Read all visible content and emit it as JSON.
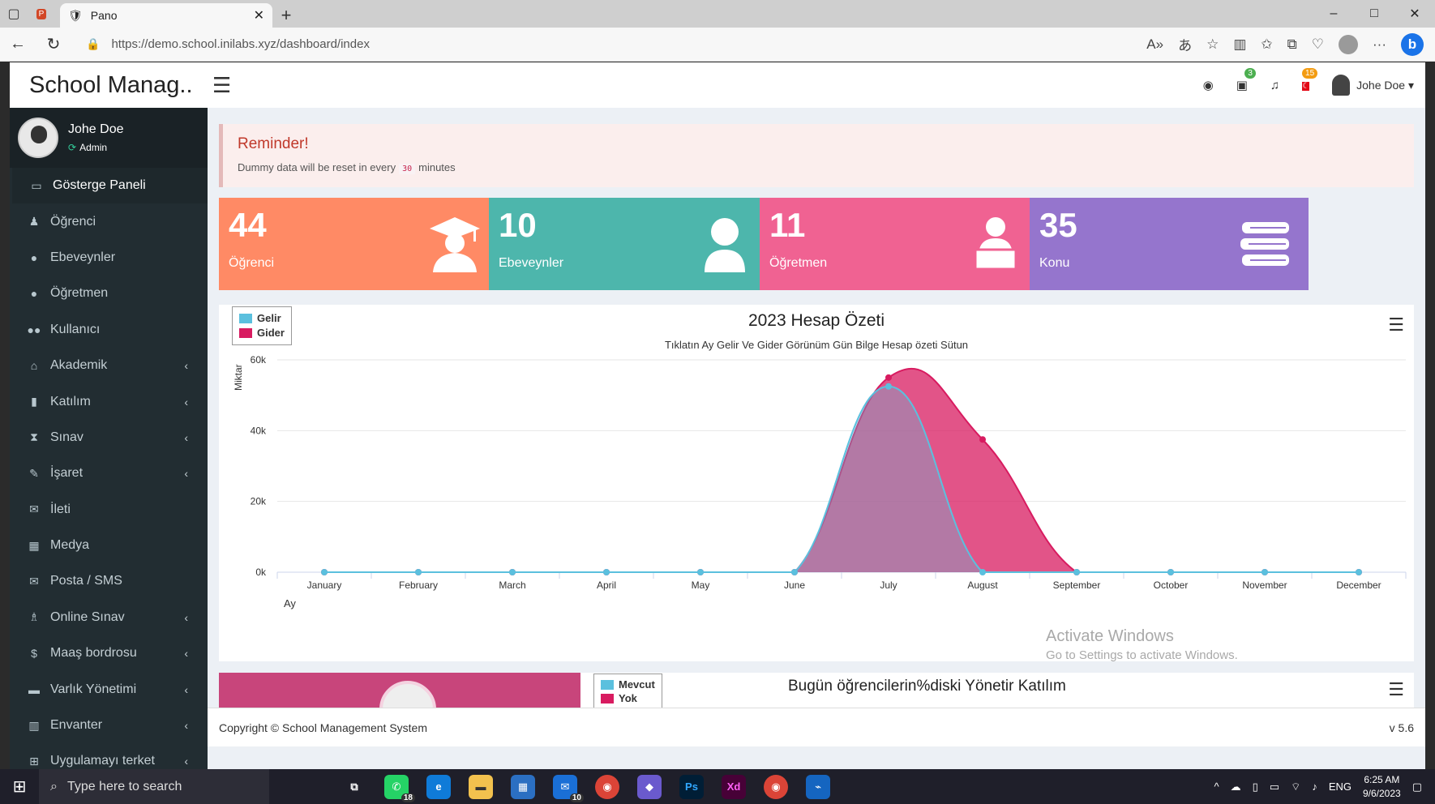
{
  "browser": {
    "tab_title": "Pano",
    "url_host": "https://demo.school.inilabs.xyz",
    "url_path": "/dashboard/index",
    "new_tab": "+",
    "win_min": "–",
    "win_max": "□",
    "win_close": "✕"
  },
  "app": {
    "logo": "School Manag..",
    "user_name": "Johe Doe",
    "user_role": "Admin",
    "badge_calendar": "3",
    "badge_flag": "15",
    "top_user": "Johe Doe ▾"
  },
  "sidebar": {
    "items": [
      {
        "label": "Gösterge Paneli",
        "icon": "laptop-icon",
        "glyph": "▭",
        "caret": ""
      },
      {
        "label": "Öğrenci",
        "icon": "student-icon",
        "glyph": "♟",
        "caret": ""
      },
      {
        "label": "Ebeveynler",
        "icon": "user-icon",
        "glyph": "●",
        "caret": ""
      },
      {
        "label": "Öğretmen",
        "icon": "teacher-icon",
        "glyph": "●",
        "caret": ""
      },
      {
        "label": "Kullanıcı",
        "icon": "users-icon",
        "glyph": "●●",
        "caret": ""
      },
      {
        "label": "Akademik",
        "icon": "bank-icon",
        "glyph": "⌂",
        "caret": "‹"
      },
      {
        "label": "Katılım",
        "icon": "clipboard-icon",
        "glyph": "▮",
        "caret": "‹"
      },
      {
        "label": "Sınav",
        "icon": "hourglass-icon",
        "glyph": "⧗",
        "caret": "‹"
      },
      {
        "label": "İşaret",
        "icon": "edit-icon",
        "glyph": "✎",
        "caret": "‹"
      },
      {
        "label": "İleti",
        "icon": "envelope-icon",
        "glyph": "✉",
        "caret": ""
      },
      {
        "label": "Medya",
        "icon": "film-icon",
        "glyph": "▦",
        "caret": ""
      },
      {
        "label": "Posta / SMS",
        "icon": "envelope-open-icon",
        "glyph": "✉",
        "caret": ""
      },
      {
        "label": "Online Sınav",
        "icon": "graduation-cap-icon",
        "glyph": "♗",
        "caret": "‹"
      },
      {
        "label": "Maaş bordrosu",
        "icon": "dollar-icon",
        "glyph": "$",
        "caret": "‹"
      },
      {
        "label": "Varlık Yönetimi",
        "icon": "briefcase-icon",
        "glyph": "▬",
        "caret": "‹"
      },
      {
        "label": "Envanter",
        "icon": "building-icon",
        "glyph": "▥",
        "caret": "‹"
      },
      {
        "label": "Uygulamayı terket",
        "icon": "exit-icon",
        "glyph": "⊞",
        "caret": "‹"
      }
    ]
  },
  "reminder": {
    "title": "Reminder!",
    "text_before": "Dummy data will be reset in every",
    "minutes_value": "30",
    "text_after": "minutes"
  },
  "stats": [
    {
      "value": "44",
      "label": "Öğrenci",
      "color": "#ff8a65",
      "icon": "graduate-icon"
    },
    {
      "value": "10",
      "label": "Ebeveynler",
      "color": "#4db6ac",
      "icon": "user-icon"
    },
    {
      "value": "11",
      "label": "Öğretmen",
      "color": "#f06292",
      "icon": "teacher-icon"
    },
    {
      "value": "35",
      "label": "Konu",
      "color": "#9575cd",
      "icon": "books-icon"
    }
  ],
  "chart_data": {
    "type": "area",
    "title": "2023 Hesap Özeti",
    "subtitle": "Tıklatın Ay Gelir Ve Gider Görünüm Gün Bilge Hesap özeti Sütun",
    "xlabel": "Ay",
    "ylabel": "Miktar",
    "ylim": [
      0,
      60000
    ],
    "yticks": [
      "0k",
      "20k",
      "40k",
      "60k"
    ],
    "categories": [
      "January",
      "February",
      "March",
      "April",
      "May",
      "June",
      "July",
      "August",
      "September",
      "October",
      "November",
      "December"
    ],
    "series": [
      {
        "name": "Gelir",
        "color": "#5bc0de",
        "values": [
          0,
          0,
          0,
          0,
          0,
          0,
          52500,
          0,
          0,
          0,
          0,
          0
        ]
      },
      {
        "name": "Gider",
        "color": "#d81b60",
        "values": [
          0,
          0,
          0,
          0,
          0,
          0,
          55000,
          37500,
          0,
          0,
          0,
          0
        ]
      }
    ],
    "grid": true,
    "legend": "top-left"
  },
  "attendance": {
    "title": "Bugün öğrencilerin%diski Yönetir Katılım",
    "legend": [
      {
        "name": "Mevcut",
        "color": "#5bc0de"
      },
      {
        "name": "Yok",
        "color": "#d81b60"
      }
    ]
  },
  "watermark": {
    "line1": "Activate Windows",
    "line2": "Go to Settings to activate Windows."
  },
  "footer": {
    "copyright": "Copyright © School Management System",
    "version": "v 5.6"
  },
  "taskbar": {
    "search_placeholder": "Type here to search",
    "whatsapp_badge": "18",
    "mail_badge": "10",
    "lang": "ENG",
    "time": "6:25 AM",
    "date": "9/6/2023"
  }
}
